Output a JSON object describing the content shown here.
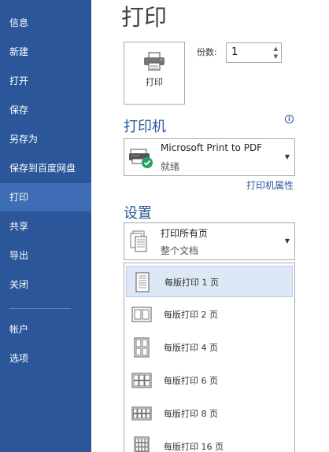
{
  "sidebar": {
    "items": [
      {
        "label": "信息"
      },
      {
        "label": "新建"
      },
      {
        "label": "打开"
      },
      {
        "label": "保存"
      },
      {
        "label": "另存为"
      },
      {
        "label": "保存到百度网盘"
      },
      {
        "label": "打印"
      },
      {
        "label": "共享"
      },
      {
        "label": "导出"
      },
      {
        "label": "关闭"
      },
      {
        "label": "帐户"
      },
      {
        "label": "选项"
      }
    ],
    "active": "打印"
  },
  "page": {
    "title": "打印"
  },
  "print_button": {
    "label": "打印"
  },
  "copies": {
    "label": "份数:",
    "value": "1"
  },
  "printer": {
    "section_title": "打印机",
    "name": "Microsoft Print to PDF",
    "status": "就绪",
    "properties_link": "打印机属性"
  },
  "settings": {
    "section_title": "设置",
    "selected_main": "打印所有页",
    "selected_sub": "整个文档",
    "options": [
      {
        "label": "每版打印 1 页",
        "pages": 1
      },
      {
        "label": "每版打印 2 页",
        "pages": 2
      },
      {
        "label": "每版打印 4 页",
        "pages": 4
      },
      {
        "label": "每版打印 6 页",
        "pages": 6
      },
      {
        "label": "每版打印 8 页",
        "pages": 8
      },
      {
        "label": "每版打印 16 页",
        "pages": 16
      }
    ]
  },
  "colors": {
    "sidebar": "#2b579a",
    "sidebar_active": "#3e6db5",
    "accent": "#2b579a",
    "selected_option": "#dde8f6",
    "ready_check": "#21a366"
  }
}
